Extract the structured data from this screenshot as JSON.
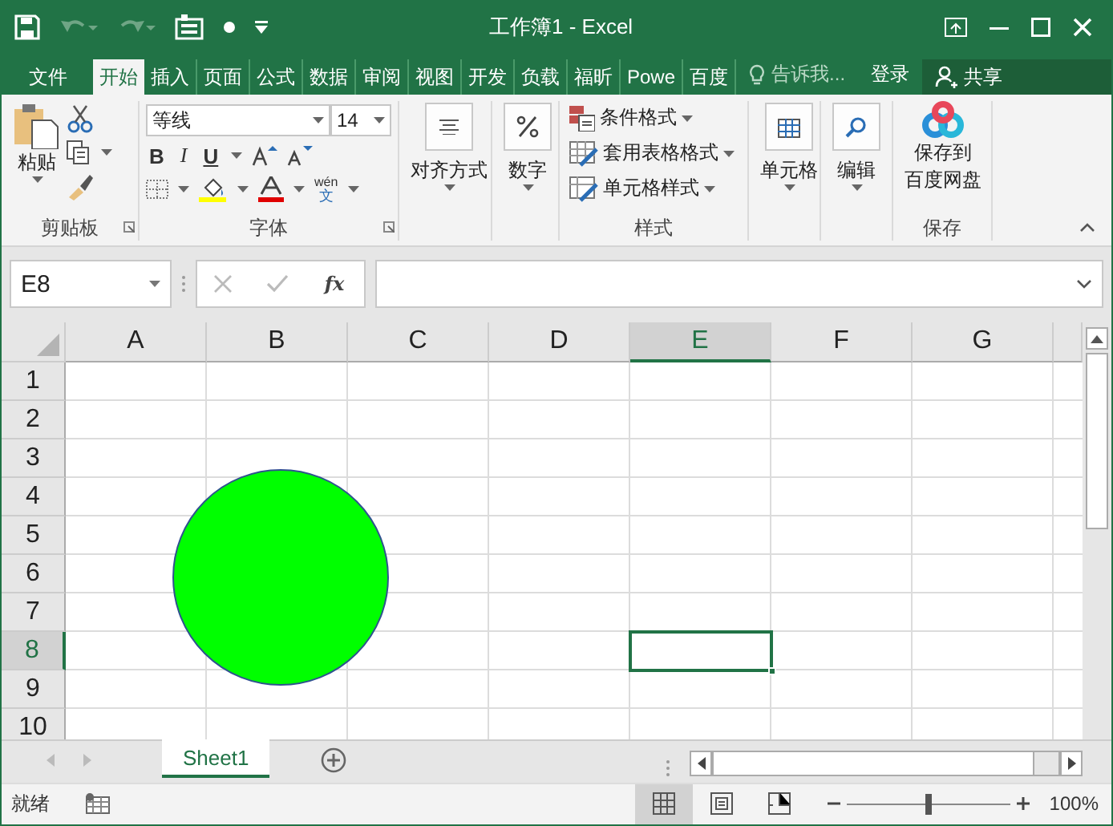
{
  "window": {
    "title": "工作簿1 - Excel"
  },
  "quick_access": [
    {
      "kind": "save",
      "disabled": false
    },
    {
      "kind": "undo",
      "disabled": true
    },
    {
      "kind": "redo",
      "disabled": true
    },
    {
      "kind": "form",
      "disabled": false
    },
    {
      "kind": "touch",
      "disabled": false
    },
    {
      "kind": "customize",
      "disabled": false
    }
  ],
  "tabs": [
    {
      "label": "文件",
      "selected": false
    },
    {
      "label": "开始",
      "selected": true
    },
    {
      "label": "插入",
      "selected": false
    },
    {
      "label": "页面",
      "selected": false
    },
    {
      "label": "公式",
      "selected": false
    },
    {
      "label": "数据",
      "selected": false
    },
    {
      "label": "审阅",
      "selected": false
    },
    {
      "label": "视图",
      "selected": false
    },
    {
      "label": "开发",
      "selected": false
    },
    {
      "label": "负载",
      "selected": false
    },
    {
      "label": "福昕",
      "selected": false
    },
    {
      "label": "Powe",
      "selected": false
    },
    {
      "label": "百度",
      "selected": false
    }
  ],
  "tell_me": {
    "placeholder": "告诉我..."
  },
  "sign_in": "登录",
  "share": "共享",
  "ribbon": {
    "clipboard": {
      "paste": "粘贴",
      "label": "剪贴板"
    },
    "font": {
      "font_name": "等线",
      "font_size": "14",
      "bold": "B",
      "italic": "I",
      "underline": "U",
      "phonetic_top": "wén",
      "phonetic_bottom": "文",
      "label": "字体"
    },
    "alignment": {
      "label": "对齐方式"
    },
    "number": {
      "label": "数字"
    },
    "styles": {
      "items": [
        {
          "kind": "conditional",
          "label": "条件格式"
        },
        {
          "kind": "table",
          "label": "套用表格格式"
        },
        {
          "kind": "cell",
          "label": "单元格样式"
        }
      ],
      "label": "样式"
    },
    "cells": {
      "label": "单元格"
    },
    "editing": {
      "label": "编辑"
    },
    "save": {
      "lines": [
        "保存到",
        "百度网盘"
      ],
      "label": "保存"
    }
  },
  "formula_bar": {
    "name_box": "E8",
    "fx": "fx"
  },
  "columns": [
    {
      "label": "A",
      "selected": false
    },
    {
      "label": "B",
      "selected": false
    },
    {
      "label": "C",
      "selected": false
    },
    {
      "label": "D",
      "selected": false
    },
    {
      "label": "E",
      "selected": true
    },
    {
      "label": "F",
      "selected": false
    },
    {
      "label": "G",
      "selected": false
    }
  ],
  "rows": [
    {
      "label": "1",
      "selected": false
    },
    {
      "label": "2",
      "selected": false
    },
    {
      "label": "3",
      "selected": false
    },
    {
      "label": "4",
      "selected": false
    },
    {
      "label": "5",
      "selected": false
    },
    {
      "label": "6",
      "selected": false
    },
    {
      "label": "7",
      "selected": false
    },
    {
      "label": "8",
      "selected": true
    },
    {
      "label": "9",
      "selected": false
    },
    {
      "label": "10",
      "selected": false
    }
  ],
  "shapes": [
    {
      "kind": "circle"
    }
  ],
  "sheets": [
    {
      "label": "Sheet1",
      "selected": true
    }
  ],
  "status_bar": {
    "status": "就绪",
    "views": [
      {
        "kind": "normal",
        "selected": true
      },
      {
        "kind": "layout",
        "selected": false
      },
      {
        "kind": "pagebreak",
        "selected": false
      }
    ],
    "zoom": {
      "level": 0.5,
      "reading": "100%"
    }
  }
}
